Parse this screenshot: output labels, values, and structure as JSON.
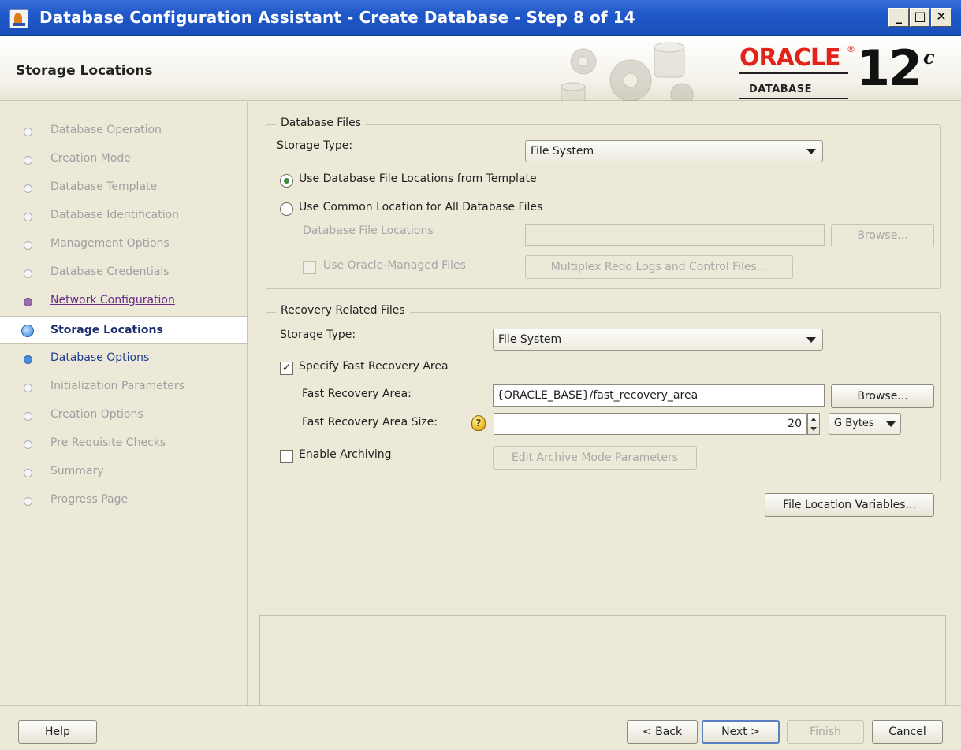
{
  "window": {
    "title": "Database Configuration Assistant - Create Database - Step 8 of 14",
    "min_label": "_",
    "max_label": "□",
    "close_label": "✕"
  },
  "header": {
    "page_title": "Storage Locations",
    "logo_word": "ORACLE",
    "logo_sub": "DATABASE",
    "logo_version": "12",
    "logo_version_sup": "c"
  },
  "nav": {
    "items": [
      {
        "label": "Database Operation",
        "state": "done"
      },
      {
        "label": "Creation Mode",
        "state": "done"
      },
      {
        "label": "Database Template",
        "state": "done"
      },
      {
        "label": "Database Identification",
        "state": "done"
      },
      {
        "label": "Management Options",
        "state": "done"
      },
      {
        "label": "Database Credentials",
        "state": "done"
      },
      {
        "label": "Network Configuration",
        "state": "visited"
      },
      {
        "label": "Storage Locations",
        "state": "current"
      },
      {
        "label": "Database Options",
        "state": "link"
      },
      {
        "label": "Initialization Parameters",
        "state": "pending"
      },
      {
        "label": "Creation Options",
        "state": "pending"
      },
      {
        "label": "Pre Requisite Checks",
        "state": "pending"
      },
      {
        "label": "Summary",
        "state": "pending"
      },
      {
        "label": "Progress Page",
        "state": "pending"
      }
    ]
  },
  "db_files": {
    "legend": "Database Files",
    "storage_type_label": "Storage Type:",
    "storage_type_value": "File System",
    "radio_template_label": "Use Database File Locations from Template",
    "radio_common_label": "Use Common Location for All Database Files",
    "file_locations_label": "Database File Locations",
    "file_locations_value": "",
    "browse_label": "Browse...",
    "omf_label": "Use Oracle-Managed Files",
    "multiplex_label": "Multiplex Redo Logs and Control Files..."
  },
  "recovery": {
    "legend": "Recovery Related Files",
    "storage_type_label": "Storage Type:",
    "storage_type_value": "File System",
    "specify_fra_label": "Specify Fast Recovery Area",
    "fra_label": "Fast Recovery Area:",
    "fra_value": "{ORACLE_BASE}/fast_recovery_area",
    "browse_label": "Browse...",
    "fra_size_label": "Fast Recovery Area Size:",
    "fra_size_value": "20",
    "fra_size_unit": "G Bytes",
    "hint_glyph": "?",
    "archiving_label": "Enable Archiving",
    "archive_params_label": "Edit Archive Mode Parameters"
  },
  "file_location_variables_label": "File Location Variables...",
  "footer": {
    "help": "Help",
    "back": "< Back",
    "next": "Next >",
    "finish": "Finish",
    "cancel": "Cancel"
  },
  "checkmark": "✓"
}
